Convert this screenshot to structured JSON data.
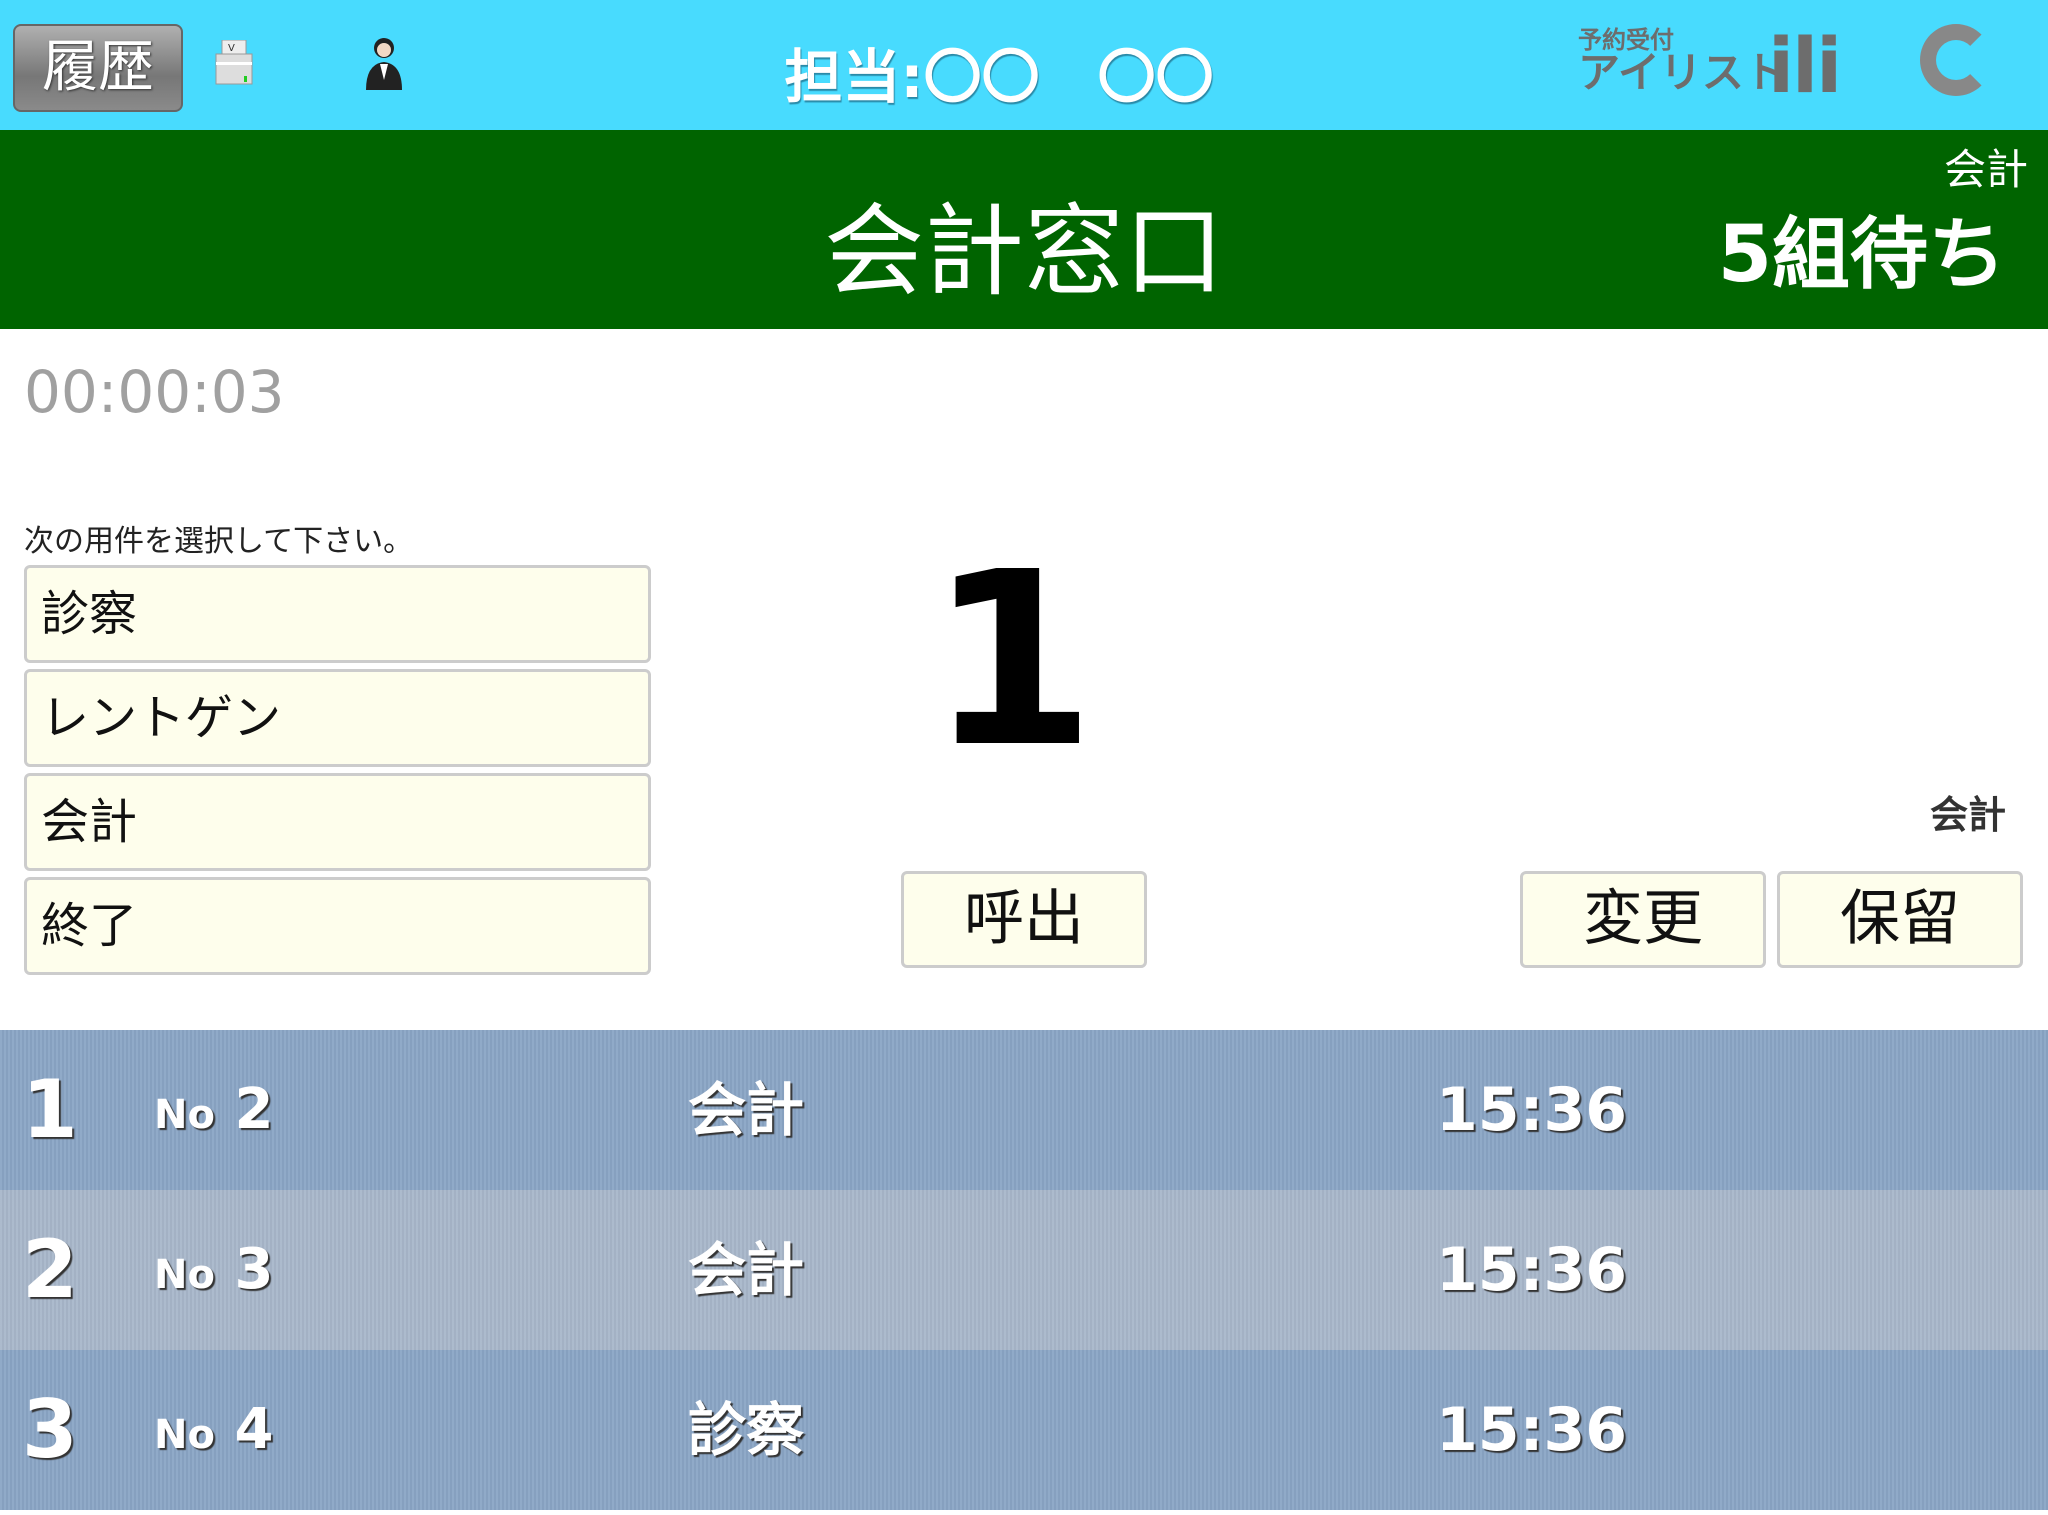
{
  "header": {
    "history_label": "履歴",
    "staff_label": "担当:〇〇　〇〇",
    "logo_small": "予約受付",
    "logo_main": "アイリスト",
    "logo_brand": "ili",
    "icons": [
      "printer-icon",
      "staff-icon",
      "refresh-icon"
    ],
    "bg_color": "#48dbfe"
  },
  "window": {
    "title": "会計窓口",
    "category": "会計",
    "waiting": "5組待ち",
    "bg_color": "#006400"
  },
  "main": {
    "timer": "00:00:03",
    "prompt": "次の用件を選択して下さい。",
    "options": [
      "診察",
      "レントゲン",
      "会計",
      "終了"
    ],
    "current_number": "1",
    "current_type": "会計",
    "call_label": "呼出",
    "change_label": "変更",
    "hold_label": "保留"
  },
  "queue": [
    {
      "rank": "1",
      "no_prefix": "No",
      "no": "2",
      "type": "会計",
      "time": "15:36",
      "color": "#8aa5c5"
    },
    {
      "rank": "2",
      "no_prefix": "No",
      "no": "3",
      "type": "会計",
      "time": "15:36",
      "color": "#a8b7ca"
    },
    {
      "rank": "3",
      "no_prefix": "No",
      "no": "4",
      "type": "診察",
      "time": "15:36",
      "color": "#8aa5c5"
    }
  ]
}
